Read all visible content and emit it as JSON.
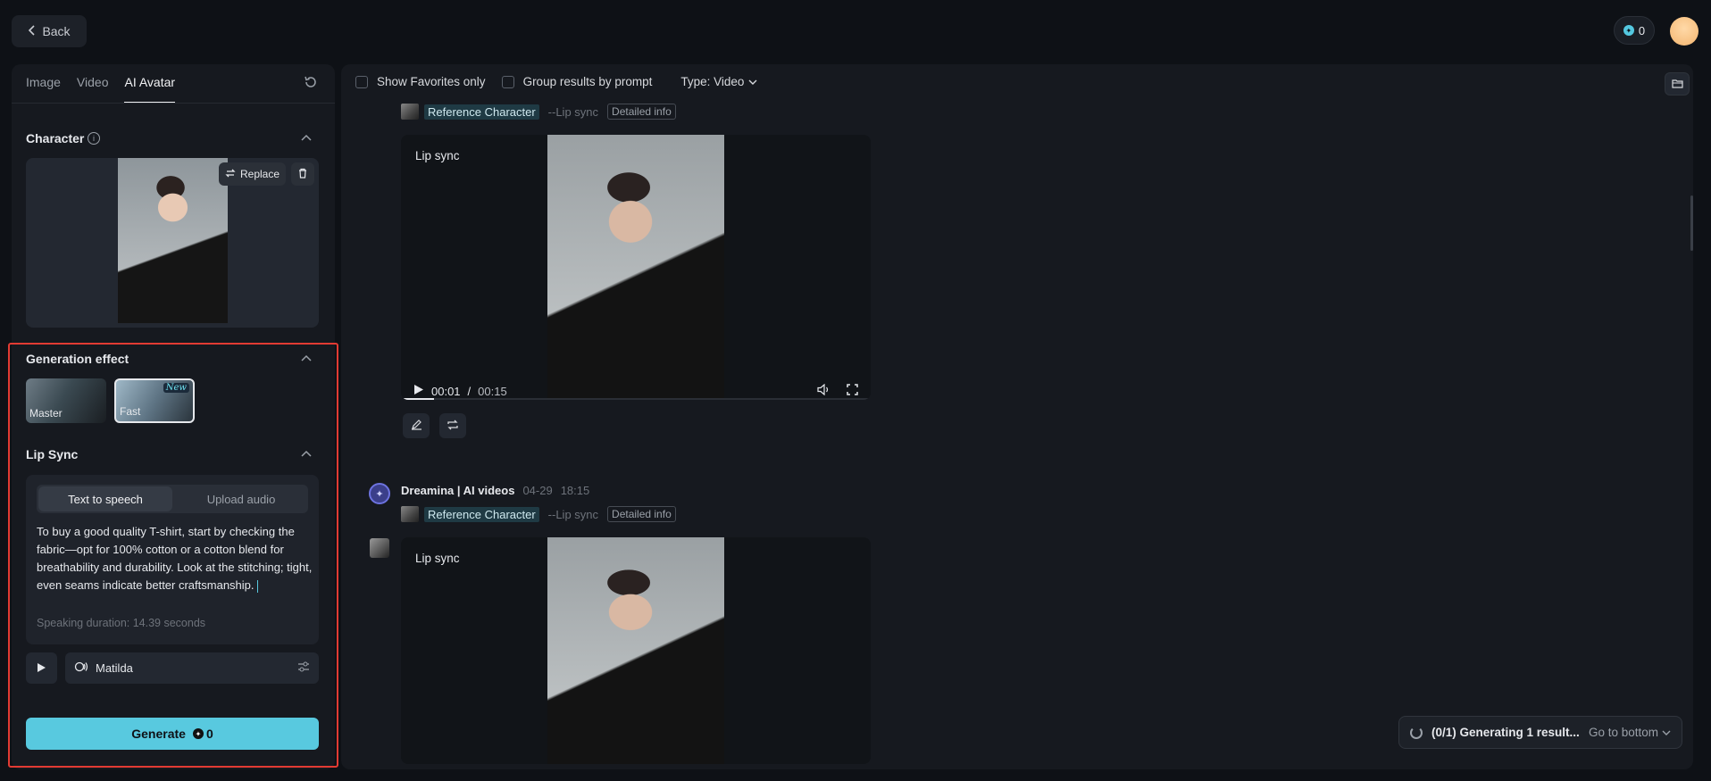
{
  "topbar": {
    "back_label": "Back",
    "credits": "0"
  },
  "left": {
    "tabs": [
      {
        "label": "Image"
      },
      {
        "label": "Video"
      },
      {
        "label": "AI Avatar"
      }
    ],
    "character": {
      "title": "Character",
      "replace_label": "Replace"
    },
    "generation_effect": {
      "title": "Generation effect",
      "options": [
        {
          "label": "Master"
        },
        {
          "label": "Fast",
          "badge": "New"
        }
      ]
    },
    "lip_sync": {
      "title": "Lip Sync",
      "mode_tabs": [
        {
          "label": "Text to speech"
        },
        {
          "label": "Upload audio"
        }
      ],
      "text": "To buy a good quality T-shirt, start by checking the fabric—opt for 100% cotton or a cotton blend for breathability and durability. Look at the stitching; tight, even seams indicate better craftsmanship.",
      "duration": "Speaking duration: 14.39 seconds",
      "voice": "Matilda"
    },
    "generate": {
      "label": "Generate",
      "cost": "0"
    }
  },
  "right": {
    "filters": {
      "favorites_label": "Show Favorites only",
      "group_label": "Group results by prompt",
      "type_label": "Type: Video"
    },
    "items": [
      {
        "ref_name": "Reference Character",
        "mode": "--Lip sync",
        "detail": "Detailed info",
        "video_label": "Lip sync",
        "time_current": "00:01",
        "time_sep": "/",
        "time_total": "00:15",
        "progress": 0.07
      },
      {
        "author": "Dreamina | AI videos",
        "date": "04-29",
        "time": "18:15",
        "ref_name": "Reference Character",
        "mode": "--Lip sync",
        "detail": "Detailed info",
        "video_label": "Lip sync"
      }
    ],
    "status": {
      "text": "(0/1) Generating 1 result...",
      "goto_label": "Go to bottom"
    }
  },
  "colors": {
    "accent": "#58c9df",
    "highlight": "#e23b33",
    "background": "#0e1116"
  }
}
